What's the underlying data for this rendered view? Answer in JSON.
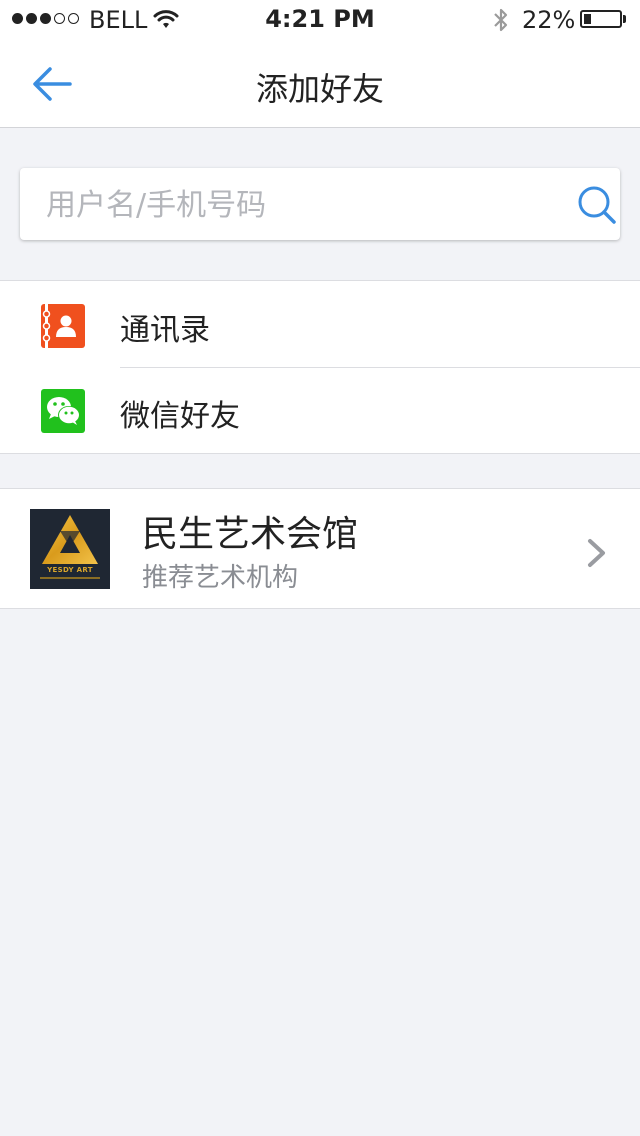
{
  "status_bar": {
    "carrier": "BELL",
    "time": "4:21 PM",
    "battery_percent": "22%",
    "battery_level": 0.22,
    "signal_bars": 3,
    "signal_total": 5
  },
  "nav": {
    "title": "添加好友",
    "back_icon": "arrow-left-icon"
  },
  "search": {
    "placeholder": "用户名/手机号码",
    "value": ""
  },
  "friend_sources": [
    {
      "label": "通讯录",
      "icon": "contacts-icon",
      "color": "#f0501e"
    },
    {
      "label": "微信好友",
      "icon": "wechat-icon",
      "color": "#21c11d"
    }
  ],
  "recommended": {
    "name": "民生艺术会馆",
    "subtitle": "推荐艺术机构",
    "logo_text": "YESDY ART"
  },
  "colors": {
    "accent": "#3a8de0",
    "background": "#f2f3f7"
  }
}
